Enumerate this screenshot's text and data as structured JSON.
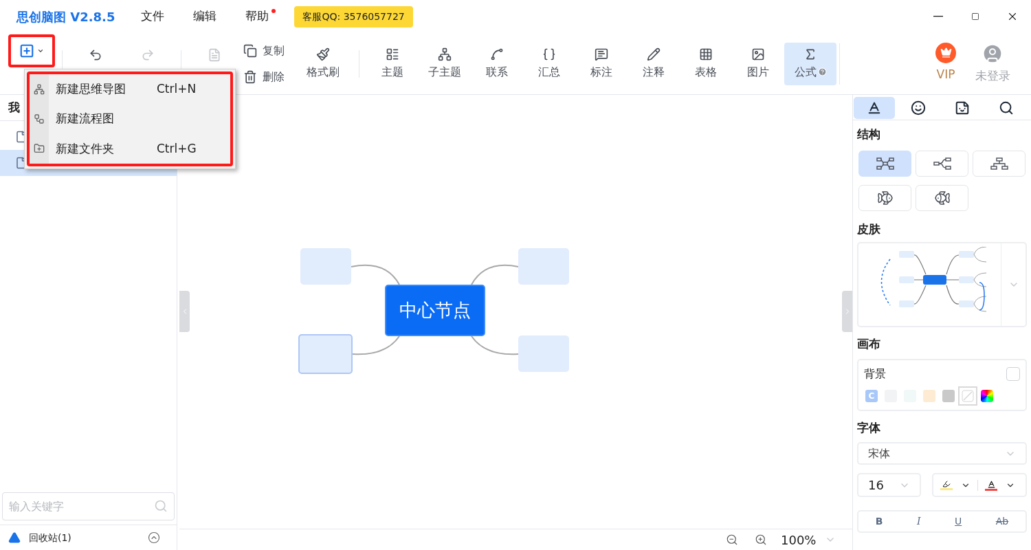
{
  "app": {
    "title": "思创脑图 V2.8.5",
    "menus": [
      {
        "label": "文件",
        "dot": false
      },
      {
        "label": "编辑",
        "dot": false
      },
      {
        "label": "帮助",
        "dot": true
      }
    ],
    "support": "客服QQ: 3576057727"
  },
  "new_button_highlighted": true,
  "toolbar": [
    {
      "kind": "new",
      "disabled": false,
      "selected": false
    },
    {
      "kind": "undo",
      "disabled": false,
      "selected": false
    },
    {
      "kind": "redo",
      "disabled": true,
      "selected": false
    },
    {
      "kind": "paste",
      "disabled": true,
      "selected": false
    },
    {
      "kind": "copy",
      "label": "复制",
      "disabled": false,
      "selected": false
    },
    {
      "kind": "delete",
      "label": "删除",
      "disabled": false,
      "selected": false
    },
    {
      "kind": "brush",
      "label": "格式刷",
      "disabled": false,
      "selected": false
    },
    {
      "kind": "topic",
      "label": "主题",
      "disabled": false,
      "selected": false
    },
    {
      "kind": "subtopic",
      "label": "子主题",
      "disabled": false,
      "selected": false
    },
    {
      "kind": "link",
      "label": "联系",
      "disabled": false,
      "selected": false
    },
    {
      "kind": "summary",
      "label": "汇总",
      "disabled": false,
      "selected": false
    },
    {
      "kind": "callout",
      "label": "标注",
      "disabled": false,
      "selected": false
    },
    {
      "kind": "note",
      "label": "注释",
      "disabled": false,
      "selected": false
    },
    {
      "kind": "table",
      "label": "表格",
      "disabled": false,
      "selected": false
    },
    {
      "kind": "image",
      "label": "图片",
      "disabled": false,
      "selected": false
    },
    {
      "kind": "formula",
      "label": "公式",
      "disabled": false,
      "selected": true
    }
  ],
  "account": [
    {
      "kind": "vip",
      "label": "VIP"
    },
    {
      "kind": "user",
      "label": "未登录"
    }
  ],
  "dropdown_menu": {
    "highlighted": true,
    "items": [
      {
        "kind": "mindmap",
        "label": "新建思维导图",
        "shortcut": "Ctrl+N"
      },
      {
        "kind": "flowchart",
        "label": "新建流程图"
      },
      {
        "kind": "folder",
        "label": "新建文件夹",
        "shortcut": "Ctrl+G"
      }
    ]
  },
  "sidebar": {
    "title": "我",
    "files": [
      {
        "selected": false
      },
      {
        "selected": true
      }
    ],
    "search": {
      "placeholder": "输入关键字"
    },
    "recycle_bin": "回收站(1)"
  },
  "canvas": {
    "center": "中心节点",
    "topics": [
      {
        "selected": false
      },
      {
        "selected": false
      },
      {
        "selected": true
      },
      {
        "selected": false
      }
    ],
    "zoom": "100%"
  },
  "right_panel": {
    "tabs": [
      {
        "kind": "style",
        "selected": true
      },
      {
        "kind": "icon",
        "selected": false
      },
      {
        "kind": "sticker",
        "selected": false
      },
      {
        "kind": "search",
        "selected": false
      }
    ],
    "structure": {
      "title": "结构",
      "options": [
        {
          "kind": "mindmap",
          "selected": true
        },
        {
          "kind": "logic",
          "selected": false
        },
        {
          "kind": "org",
          "selected": false
        },
        {
          "kind": "fish-right",
          "selected": false
        },
        {
          "kind": "fish-left",
          "selected": false
        }
      ]
    },
    "skin": {
      "title": "皮肤"
    },
    "canvas": {
      "title": "画布",
      "background_label": "背景",
      "background_checked": false,
      "swatches": [
        {
          "kind": "custom",
          "label": "C",
          "color": "#a9c8fa",
          "selected": false
        },
        {
          "kind": "color",
          "color": "#f2f3f5",
          "selected": false
        },
        {
          "kind": "color",
          "color": "#f1f8f8",
          "selected": false
        },
        {
          "kind": "color",
          "color": "#fdecd3",
          "selected": false
        },
        {
          "kind": "color",
          "color": "#c9c9c9",
          "selected": false
        },
        {
          "kind": "none",
          "selected": true
        },
        {
          "kind": "rainbow",
          "selected": false
        }
      ]
    },
    "font": {
      "title": "字体",
      "family": "宋体",
      "size": "16",
      "color_buttons": [
        {
          "kind": "highlight",
          "color": "#fbe98a"
        },
        {
          "kind": "text",
          "color": "#f04b4b"
        }
      ],
      "styles": [
        {
          "kind": "bold",
          "label": "B"
        },
        {
          "kind": "italic",
          "label": "I"
        },
        {
          "kind": "underline",
          "label": "U"
        },
        {
          "kind": "strike",
          "label": "Ab"
        }
      ]
    }
  }
}
